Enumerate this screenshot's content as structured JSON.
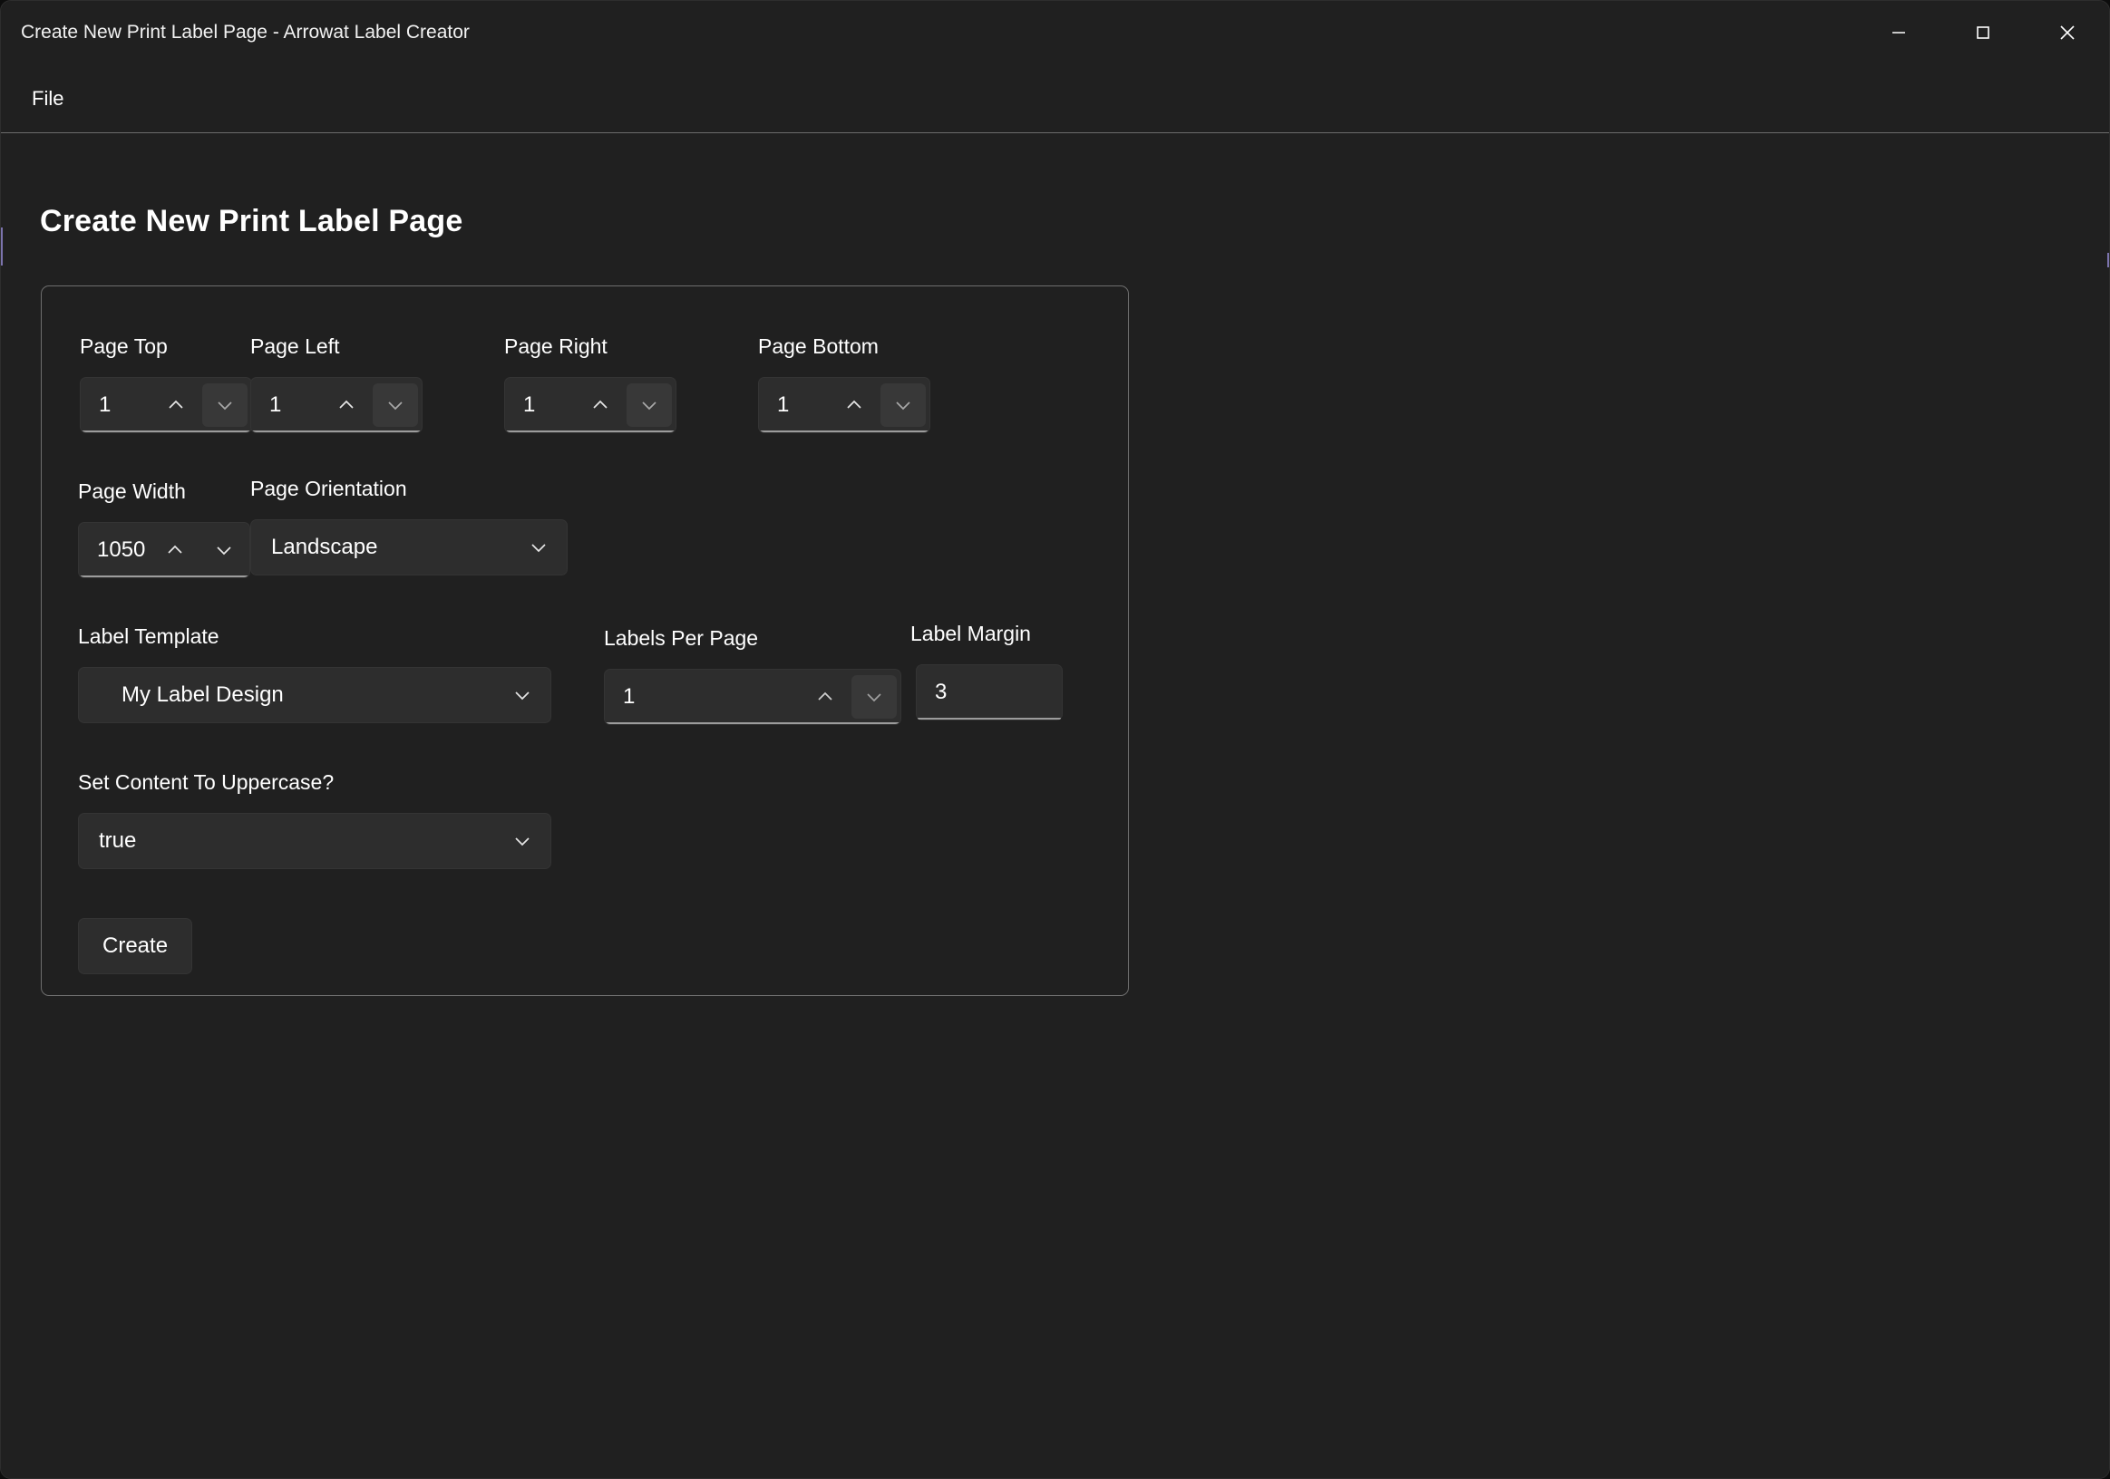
{
  "window": {
    "title": "Create New Print Label Page - Arrowat Label Creator",
    "controls": {
      "minimize": "minimize-icon",
      "maximize": "maximize-icon",
      "close": "close-icon"
    }
  },
  "menubar": {
    "items": [
      {
        "label": "File"
      }
    ]
  },
  "page": {
    "title": "Create New Print Label Page"
  },
  "form": {
    "page_top": {
      "label": "Page Top",
      "value": "1"
    },
    "page_left": {
      "label": "Page Left",
      "value": "1"
    },
    "page_right": {
      "label": "Page Right",
      "value": "1"
    },
    "page_bottom": {
      "label": "Page Bottom",
      "value": "1"
    },
    "page_width": {
      "label": "Page Width",
      "value": "1050"
    },
    "page_orientation": {
      "label": "Page Orientation",
      "value": "Landscape"
    },
    "label_template": {
      "label": "Label Template",
      "value": "My Label Design"
    },
    "labels_per_page": {
      "label": "Labels Per Page",
      "value": "1"
    },
    "label_margin": {
      "label": "Label Margin",
      "value": "3"
    },
    "uppercase": {
      "label": "Set Content To Uppercase?",
      "value": "true"
    },
    "create_button": {
      "label": "Create"
    }
  },
  "colors": {
    "window_bg": "#202020",
    "control_bg": "#2d2d2d",
    "control_hover": "#383838",
    "card_border": "#6e6e6e",
    "accent": "#8d84c8",
    "text": "#ffffff"
  }
}
